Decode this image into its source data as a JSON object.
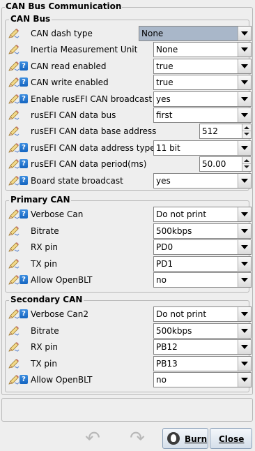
{
  "window": {
    "section_title": "CAN Bus Communication"
  },
  "groups": [
    {
      "title": "CAN Bus",
      "rows": [
        {
          "label": "CAN dash type",
          "help": false,
          "control": "combo",
          "value": "None",
          "selected": true
        },
        {
          "label": "Inertia Measurement Unit",
          "help": false,
          "control": "combo",
          "value": "None"
        },
        {
          "label": "CAN read enabled",
          "help": true,
          "control": "combo",
          "value": "true"
        },
        {
          "label": "CAN write enabled",
          "help": true,
          "control": "combo",
          "value": "true"
        },
        {
          "label": "Enable rusEFI CAN broadcast",
          "help": true,
          "control": "combo",
          "value": "yes"
        },
        {
          "label": "rusEFI CAN data bus",
          "help": false,
          "control": "combo",
          "value": "first"
        },
        {
          "label": "rusEFI CAN data base address",
          "help": false,
          "control": "spin",
          "value": "512"
        },
        {
          "label": "rusEFI CAN data address type",
          "help": true,
          "control": "combo",
          "value": "11 bit"
        },
        {
          "label": "rusEFI CAN data period(ms)",
          "help": true,
          "control": "spin",
          "value": "50.00"
        },
        {
          "label": "Board state broadcast",
          "help": true,
          "control": "combo",
          "value": "yes"
        }
      ]
    },
    {
      "title": "Primary CAN",
      "rows": [
        {
          "label": "Verbose Can",
          "help": true,
          "control": "combo",
          "value": "Do not print"
        },
        {
          "label": "Bitrate",
          "help": false,
          "control": "combo",
          "value": "500kbps"
        },
        {
          "label": "RX pin",
          "help": false,
          "control": "combo",
          "value": "PD0"
        },
        {
          "label": "TX pin",
          "help": false,
          "control": "combo",
          "value": "PD1"
        },
        {
          "label": "Allow OpenBLT",
          "help": true,
          "control": "combo",
          "value": "no"
        }
      ]
    },
    {
      "title": "Secondary CAN",
      "rows": [
        {
          "label": "Verbose Can2",
          "help": true,
          "control": "combo",
          "value": "Do not print"
        },
        {
          "label": "Bitrate",
          "help": false,
          "control": "combo",
          "value": "500kbps"
        },
        {
          "label": "RX pin",
          "help": false,
          "control": "combo",
          "value": "PB12"
        },
        {
          "label": "TX pin",
          "help": false,
          "control": "combo",
          "value": "PB13"
        },
        {
          "label": "Allow OpenBLT",
          "help": true,
          "control": "combo",
          "value": "no"
        }
      ]
    }
  ],
  "footer": {
    "burn_label": "Burn",
    "close_label": "Close",
    "undo_icon": "undo-icon",
    "redo_icon": "redo-icon"
  },
  "icons": {
    "help_glyph": "?"
  }
}
